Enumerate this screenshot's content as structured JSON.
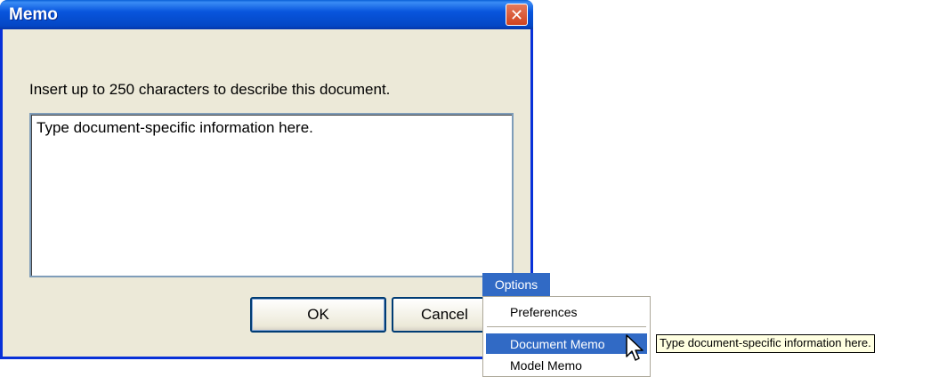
{
  "dialog": {
    "title": "Memo",
    "close_icon": "close-icon",
    "instruction": "Insert up to 250 characters to describe this document.",
    "memo_value": "Type document-specific information here.",
    "ok_label": "OK",
    "cancel_label": "Cancel"
  },
  "menu": {
    "title": "Options",
    "items": [
      {
        "label": "Preferences"
      },
      {
        "label": "Document Memo",
        "selected": true
      },
      {
        "label": "Model Memo"
      }
    ]
  },
  "tooltip": {
    "text": "Type document-specific information here."
  },
  "colors": {
    "titlebar": "#0855dd",
    "dialog_bg": "#ece9d8",
    "menu_highlight": "#316ac5",
    "tooltip_bg": "#ffffe1",
    "close_button": "#d1431e"
  }
}
